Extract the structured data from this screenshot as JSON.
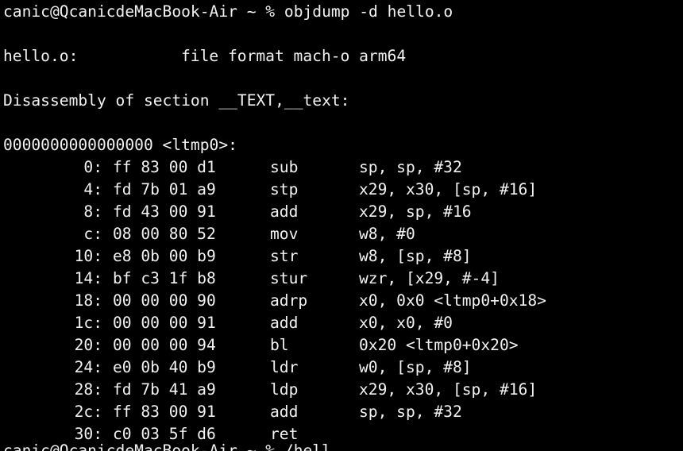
{
  "terminal": {
    "prompt_line": "canic@QcanicdeMacBook-Air ~ % objdump -d hello.o",
    "file_label": "hello.o:",
    "file_format": "file format mach-o arm64",
    "disassembly_header": "Disassembly of section __TEXT,__text:",
    "symbol_line": "0000000000000000 <ltmp0>:",
    "instructions": [
      {
        "addr": "0:",
        "bytes": "ff 83 00 d1",
        "mnemonic": "sub",
        "operands": "sp, sp, #32"
      },
      {
        "addr": "4:",
        "bytes": "fd 7b 01 a9",
        "mnemonic": "stp",
        "operands": "x29, x30, [sp, #16]"
      },
      {
        "addr": "8:",
        "bytes": "fd 43 00 91",
        "mnemonic": "add",
        "operands": "x29, sp, #16"
      },
      {
        "addr": "c:",
        "bytes": "08 00 80 52",
        "mnemonic": "mov",
        "operands": "w8, #0"
      },
      {
        "addr": "10:",
        "bytes": "e8 0b 00 b9",
        "mnemonic": "str",
        "operands": "w8, [sp, #8]"
      },
      {
        "addr": "14:",
        "bytes": "bf c3 1f b8",
        "mnemonic": "stur",
        "operands": "wzr, [x29, #-4]"
      },
      {
        "addr": "18:",
        "bytes": "00 00 00 90",
        "mnemonic": "adrp",
        "operands": "x0, 0x0 <ltmp0+0x18>"
      },
      {
        "addr": "1c:",
        "bytes": "00 00 00 91",
        "mnemonic": "add",
        "operands": "x0, x0, #0"
      },
      {
        "addr": "20:",
        "bytes": "00 00 00 94",
        "mnemonic": "bl",
        "operands": "0x20 <ltmp0+0x20>"
      },
      {
        "addr": "24:",
        "bytes": "e0 0b 40 b9",
        "mnemonic": "ldr",
        "operands": "w0, [sp, #8]"
      },
      {
        "addr": "28:",
        "bytes": "fd 7b 41 a9",
        "mnemonic": "ldp",
        "operands": "x29, x30, [sp, #16]"
      },
      {
        "addr": "2c:",
        "bytes": "ff 83 00 91",
        "mnemonic": "add",
        "operands": "sp, sp, #32"
      },
      {
        "addr": "30:",
        "bytes": "c0 03 5f d6",
        "mnemonic": "ret",
        "operands": ""
      }
    ],
    "partial_next_prompt": "canic@QcanicdeMacBook-Air ~ % /hell"
  },
  "colors": {
    "background": "#000000",
    "text": "#f2f2f2"
  }
}
